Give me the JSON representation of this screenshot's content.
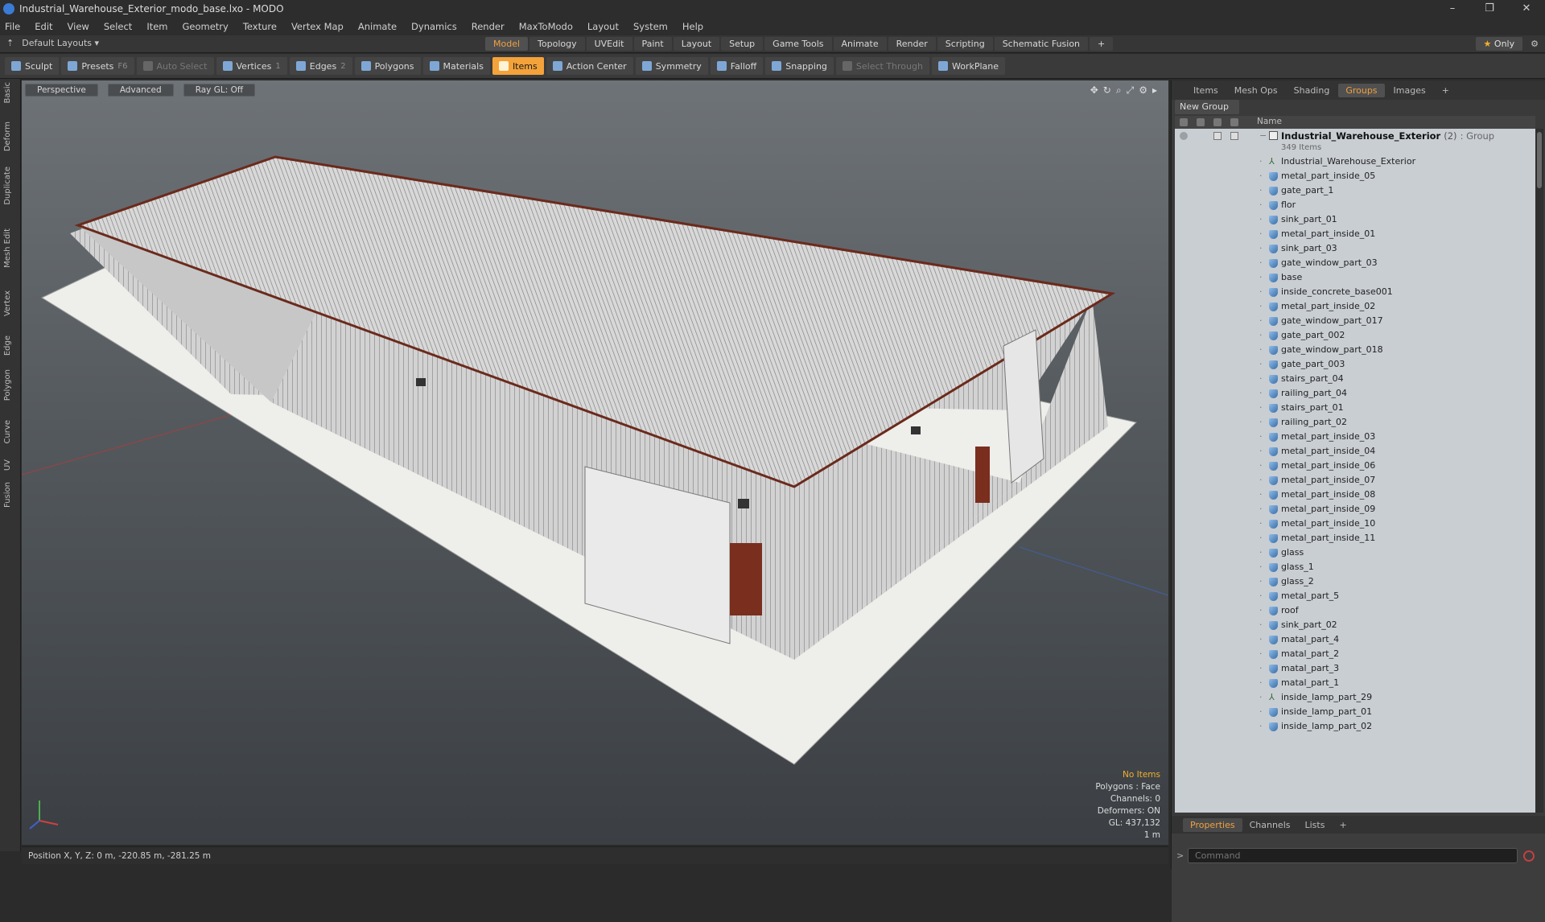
{
  "window": {
    "title": "Industrial_Warehouse_Exterior_modo_base.lxo - MODO",
    "controls": [
      "–",
      "❐",
      "✕"
    ]
  },
  "menu": [
    "File",
    "Edit",
    "View",
    "Select",
    "Item",
    "Geometry",
    "Texture",
    "Vertex Map",
    "Animate",
    "Dynamics",
    "Render",
    "MaxToModo",
    "Layout",
    "System",
    "Help"
  ],
  "layoutbar": {
    "layouts": "Default Layouts ▾",
    "tabs": [
      "Model",
      "Topology",
      "UVEdit",
      "Paint",
      "Layout",
      "Setup",
      "Game Tools",
      "Animate",
      "Render",
      "Scripting",
      "Schematic Fusion"
    ],
    "active_tab": "Model",
    "add": "+",
    "only": "Only",
    "gear": "⚙"
  },
  "toolbar": {
    "sculpt": "Sculpt",
    "presets": "Presets",
    "presets_key": "F6",
    "auto_select": "Auto Select",
    "vertices": "Vertices",
    "vertices_key": "1",
    "edges": "Edges",
    "edges_key": "2",
    "polygons": "Polygons",
    "materials": "Materials",
    "items": "Items",
    "action_center": "Action Center",
    "symmetry": "Symmetry",
    "falloff": "Falloff",
    "snapping": "Snapping",
    "select_through": "Select Through",
    "workplane": "WorkPlane"
  },
  "left_tabs": [
    "Basic",
    "Deform",
    "Duplicate",
    "Mesh Edit",
    "Vertex",
    "Edge",
    "Polygon",
    "Curve",
    "UV",
    "Fusion"
  ],
  "viewport": {
    "view": "Perspective",
    "shading": "Advanced",
    "raygl": "Ray GL: Off",
    "info": {
      "no_items": "No Items",
      "polygons": "Polygons : Face",
      "channels": "Channels: 0",
      "deformers": "Deformers: ON",
      "gl": "GL: 437,132",
      "scale": "1 m"
    }
  },
  "status": {
    "position": "Position X, Y, Z:  0 m, -220.85 m, -281.25 m"
  },
  "right_panel": {
    "tabs": [
      "Items",
      "Mesh Ops",
      "Shading",
      "Groups",
      "Images",
      "+"
    ],
    "active_tab": "Groups",
    "new_group": "New Group",
    "name_col": "Name",
    "group": {
      "name": "Industrial_Warehouse_Exterior",
      "count": "(2)",
      "type": ": Group",
      "sub": "349 Items"
    },
    "items": [
      "Industrial_Warehouse_Exterior",
      "metal_part_inside_05",
      "gate_part_1",
      "flor",
      "sink_part_01",
      "metal_part_inside_01",
      "sink_part_03",
      "gate_window_part_03",
      "base",
      "inside_concrete_base001",
      "metal_part_inside_02",
      "gate_window_part_017",
      "gate_part_002",
      "gate_window_part_018",
      "gate_part_003",
      "stairs_part_04",
      "railing_part_04",
      "stairs_part_01",
      "railing_part_02",
      "metal_part_inside_03",
      "metal_part_inside_04",
      "metal_part_inside_06",
      "metal_part_inside_07",
      "metal_part_inside_08",
      "metal_part_inside_09",
      "metal_part_inside_10",
      "metal_part_inside_11",
      "glass",
      "glass_1",
      "glass_2",
      "metal_part_5",
      "roof",
      "sink_part_02",
      "matal_part_4",
      "matal_part_2",
      "matal_part_3",
      "matal_part_1",
      "inside_lamp_part_29",
      "inside_lamp_part_01",
      "inside_lamp_part_02"
    ],
    "locator_items": [
      0,
      37
    ],
    "bottom_tabs": [
      "Properties",
      "Channels",
      "Lists",
      "+"
    ],
    "bottom_active": "Properties"
  },
  "command": {
    "placeholder": "Command",
    "prompt": ">"
  }
}
